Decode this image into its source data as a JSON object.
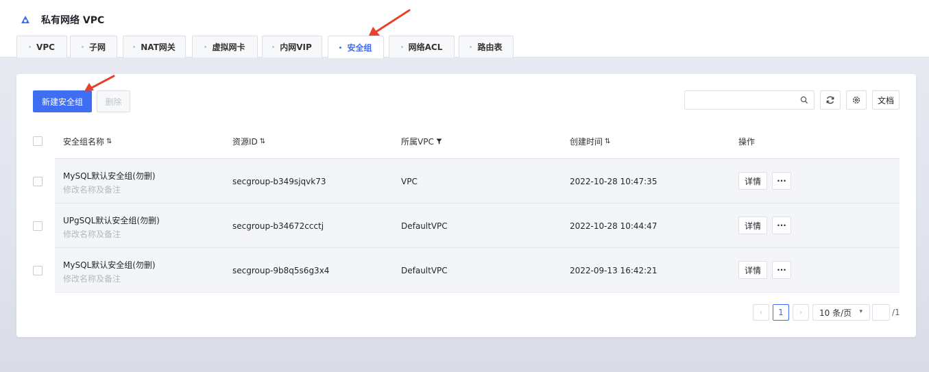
{
  "app": {
    "title": "私有网络 VPC"
  },
  "tabs": [
    {
      "label": "VPC"
    },
    {
      "label": "子网"
    },
    {
      "label": "NAT网关"
    },
    {
      "label": "虚拟网卡"
    },
    {
      "label": "内网VIP"
    },
    {
      "label": "安全组",
      "active": true
    },
    {
      "label": "网络ACL"
    },
    {
      "label": "路由表"
    }
  ],
  "toolbar": {
    "create_label": "新建安全组",
    "delete_label": "删除",
    "search_placeholder": "",
    "docs_label": "文档",
    "icons": [
      "refresh-icon",
      "gear-icon",
      "search-icon"
    ]
  },
  "table": {
    "columns": [
      "安全组名称",
      "资源ID",
      "所属VPC",
      "创建时间",
      "操作"
    ],
    "rows": [
      {
        "name": "MySQL默认安全组(勿删)",
        "sub": "修改名称及备注",
        "id": "secgroup-b349sjqvk73",
        "vpc": "VPC",
        "created": "2022-10-28 10:47:35",
        "action": "详情",
        "more": "···"
      },
      {
        "name": "UPgSQL默认安全组(勿删)",
        "sub": "修改名称及备注",
        "id": "secgroup-b34672ccctj",
        "vpc": "DefaultVPC",
        "created": "2022-10-28 10:44:47",
        "action": "详情",
        "more": "···"
      },
      {
        "name": "MySQL默认安全组(勿删)",
        "sub": "修改名称及备注",
        "id": "secgroup-9b8q5s6g3x4",
        "vpc": "DefaultVPC",
        "created": "2022-09-13 16:42:21",
        "action": "详情",
        "more": "···"
      }
    ]
  },
  "pagination": {
    "current": "1",
    "page_size": "10 条/页",
    "total": "/1"
  },
  "colors": {
    "primary": "#3f6ef2",
    "active_tab": "#3d6cf2",
    "annotation_arrow": "#e8412c"
  }
}
